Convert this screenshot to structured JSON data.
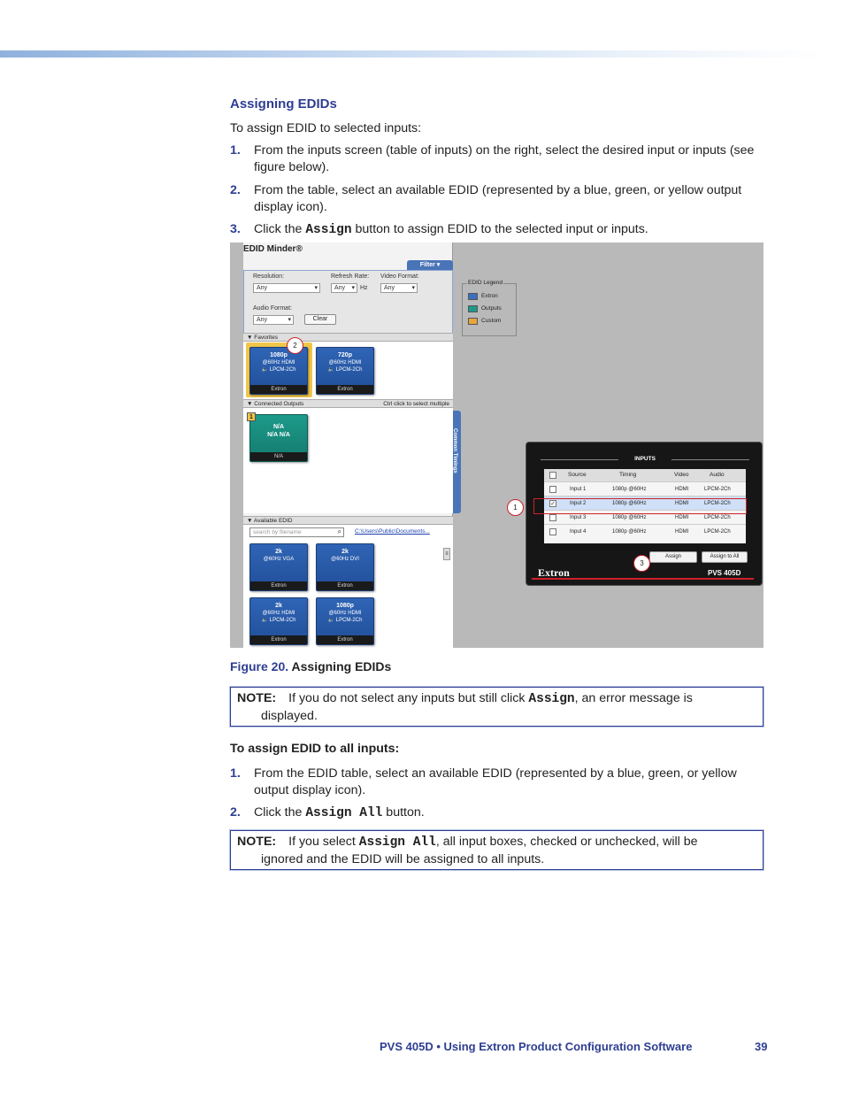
{
  "heading": "Assigning EDIDs",
  "intro": "To assign EDID to selected inputs:",
  "steps1": [
    {
      "n": "1.",
      "text": "From the inputs screen (table of inputs) on the right, select the desired input or inputs (see figure below)."
    },
    {
      "n": "2.",
      "text": "From the table, select an available EDID (represented by a blue, green, or yellow output display icon)."
    },
    {
      "n": "3.",
      "pre": "Click the ",
      "code": "Assign",
      "post": " button to assign EDID to the selected input or inputs."
    }
  ],
  "figure": {
    "panel_title": "EDID Minder®",
    "filter_tab": "Filter ▾",
    "resolution_label": "Resolution:",
    "resolution_value": "Any",
    "refresh_label": "Refresh Rate:",
    "refresh_value": "Any",
    "hz": "Hz",
    "video_format_label": "Video Format:",
    "video_format_value": "Any",
    "audio_format_label": "Audio Format:",
    "audio_format_value": "Any",
    "clear_button": "Clear",
    "legend_title": "EDID Legend",
    "legend": [
      {
        "label": "Extron",
        "color": "#3c6fc0"
      },
      {
        "label": "Outputs",
        "color": "#1d9a8a"
      },
      {
        "label": "Custom",
        "color": "#e8a53a"
      }
    ],
    "favorites_label": "▼ Favorites",
    "favorites": [
      {
        "l1": "1080p",
        "l2": "@60Hz   HDMI",
        "l3": "🔈 LPCM-2Ch",
        "foot": "Extron"
      },
      {
        "l1": "720p",
        "l2": "@60Hz   HDMI",
        "l3": "🔈 LPCM-2Ch",
        "foot": "Extron"
      }
    ],
    "connected_label": "▼ Connected Outputs",
    "connected_hint": "Ctrl click to select multiple",
    "connected": {
      "l1": "N/A",
      "l2": "N/A   N/A",
      "foot": "N/A"
    },
    "side_tab": "Common Timings",
    "available_label": "▼ Available EDID",
    "search_placeholder": "search by filename",
    "path": "C:\\Users\\Public\\Documents...",
    "available": [
      {
        "l1": "2k",
        "l2": "@60Hz    VGA",
        "l3": "",
        "foot": "Extron"
      },
      {
        "l1": "2k",
        "l2": "@60Hz    DVI",
        "l3": "",
        "foot": "Extron"
      },
      {
        "l1": "2k",
        "l2": "@60Hz   HDMI",
        "l3": "🔈 LPCM-2Ch",
        "foot": "Extron"
      },
      {
        "l1": "1080p",
        "l2": "@60Hz   HDMI",
        "l3": "🔈 LPCM-2Ch",
        "foot": "Extron"
      }
    ],
    "callouts": [
      "1",
      "2",
      "3"
    ],
    "device": {
      "title": "INPUTS",
      "headers": [
        "Source",
        "Timing",
        "Video",
        "Audio"
      ],
      "rows": [
        {
          "checked": "",
          "source": "Input 1",
          "timing": "1080p @60Hz",
          "video": "HDMI",
          "audio": "LPCM-2Ch"
        },
        {
          "checked": "✓",
          "source": "Input 2",
          "timing": "1080p @60Hz",
          "video": "HDMI",
          "audio": "LPCM-2Ch"
        },
        {
          "checked": "",
          "source": "Input 3",
          "timing": "1080p @60Hz",
          "video": "HDMI",
          "audio": "LPCM-2Ch"
        },
        {
          "checked": "",
          "source": "Input 4",
          "timing": "1080p @60Hz",
          "video": "HDMI",
          "audio": "LPCM-2Ch"
        }
      ],
      "assign_button": "Assign",
      "assign_all_button": "Assign to All",
      "brand": "Extron",
      "model": "PVS 405D"
    }
  },
  "caption": {
    "label": "Figure 20.",
    "text": " Assigning EDIDs"
  },
  "note1": {
    "label": "NOTE:",
    "pre": "If you do not select any inputs but still click ",
    "code": "Assign",
    "post": ", an error message is",
    "line2": "displayed."
  },
  "subheading": "To assign EDID to all inputs:",
  "steps2": [
    {
      "n": "1.",
      "text": "From the EDID table, select an available EDID (represented by a blue, green, or yellow output display icon)."
    },
    {
      "n": "2.",
      "pre": "Click the ",
      "code": "Assign All",
      "post": " button."
    }
  ],
  "note2": {
    "label": "NOTE:",
    "pre": "If you select ",
    "code": "Assign All",
    "post": ", all input boxes, checked or unchecked, will be",
    "line2": "ignored and the EDID will be assigned to all inputs."
  },
  "footer": {
    "text": "PVS 405D • Using Extron Product Configuration Software",
    "page": "39"
  }
}
